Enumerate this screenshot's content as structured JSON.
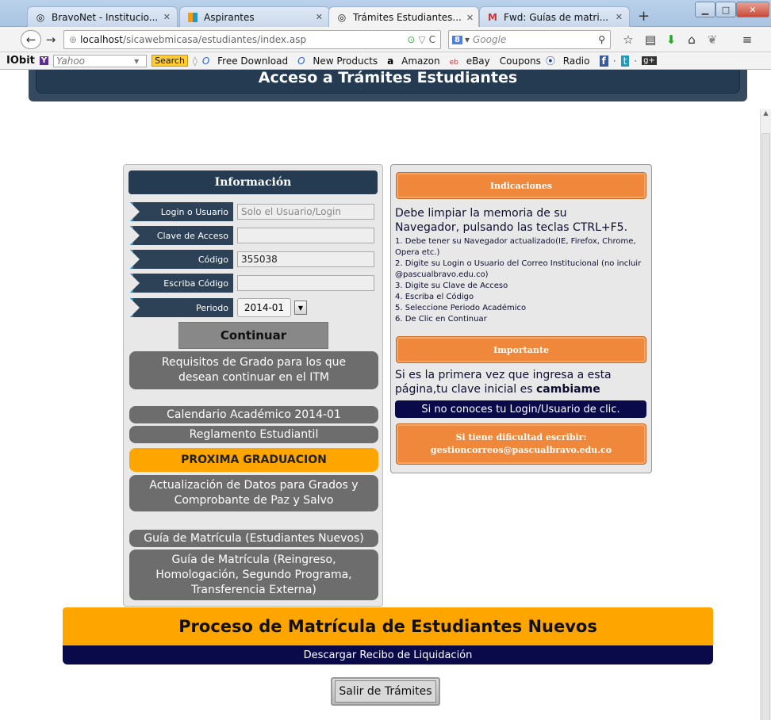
{
  "browser": {
    "tabs": [
      {
        "label": "BravoNet - Institucio...",
        "icon": "site-icon"
      },
      {
        "label": "Aspirantes",
        "icon": "tiles-icon"
      },
      {
        "label": "Trámites Estudiantes...",
        "icon": "site-icon"
      },
      {
        "label": "Fwd: Guías de matri...",
        "icon": "gmail-icon"
      }
    ],
    "url_host": "localhost",
    "url_path": "/sicawebmicasa/estudiantes/index.asp",
    "search_placeholder": "Google",
    "toolbar": {
      "brand": "IObit",
      "yahoo": "Yahoo",
      "search_btn": "Search",
      "free_download": "Free Download",
      "new_products": "New Products",
      "amazon": "Amazon",
      "ebay": "eBay",
      "coupons": "Coupons",
      "radio": "Radio"
    }
  },
  "page": {
    "header_title": "Acceso a Trámites Estudiantes",
    "info_title": "Información",
    "fields": {
      "login_label": "Login o Usuario",
      "login_placeholder": "Solo el Usuario/Login",
      "clave_label": "Clave de Acceso",
      "codigo_label": "Código",
      "codigo_value": "355038",
      "escriba_label": "Escriba Código",
      "periodo_label": "Periodo",
      "periodo_value": "2014-01"
    },
    "continuar": "Continuar",
    "links": {
      "requisitos_1": "Requisitos de Grado para los que",
      "requisitos_2": "desean continuar en el ITM",
      "calendario": "Calendario Académico 2014-01",
      "reglamento": "Reglamento Estudiantil",
      "proxima": "PROXIMA GRADUACION",
      "actualizacion_1": "Actualización de Datos para Grados y",
      "actualizacion_2": "Comprobante de Paz y Salvo",
      "guia_nuevos": "Guía de Matrícula (Estudiantes Nuevos)",
      "guia_reingreso_1": "Guía de Matrícula (Reingreso,",
      "guia_reingreso_2": "Homologación, Segundo Programa,",
      "guia_reingreso_3": "Transferencia Externa)"
    },
    "indicaciones": {
      "title": "Indicaciones",
      "intro_1": "Debe limpiar la memoria de su",
      "intro_2": "Navegador, pulsando las teclas CTRL+F5.",
      "step1": "1. Debe tener su Navegador actualizado(IE, Firefox, Chrome, Opera etc.)",
      "step2": "2. Digite su Login o Usuario del Correo Institucional (no incluir @pascualbravo.edu.co)",
      "step3": "3. Digite su Clave de Acceso",
      "step4": "4. Escriba el Código",
      "step5": "5. Seleccione Periodo Académico",
      "step6": "6. De Clic en Continuar"
    },
    "importante": {
      "title": "Importante",
      "text_1": "Si es la primera vez que ingresa a esta",
      "text_2": "página,tu clave inicial es ",
      "text_bold": "cambiame",
      "login_link": "Si no conoces tu Login/Usuario de clic.",
      "dificultad_1": "Si tiene dificultad escribir:",
      "dificultad_2": "gestioncorreos@pascualbravo.edu.co"
    },
    "proceso_title": "Proceso de Matrícula de Estudiantes Nuevos",
    "recibo": "Descargar Recibo de Liquidación",
    "salir": "Salir de Trámites"
  }
}
